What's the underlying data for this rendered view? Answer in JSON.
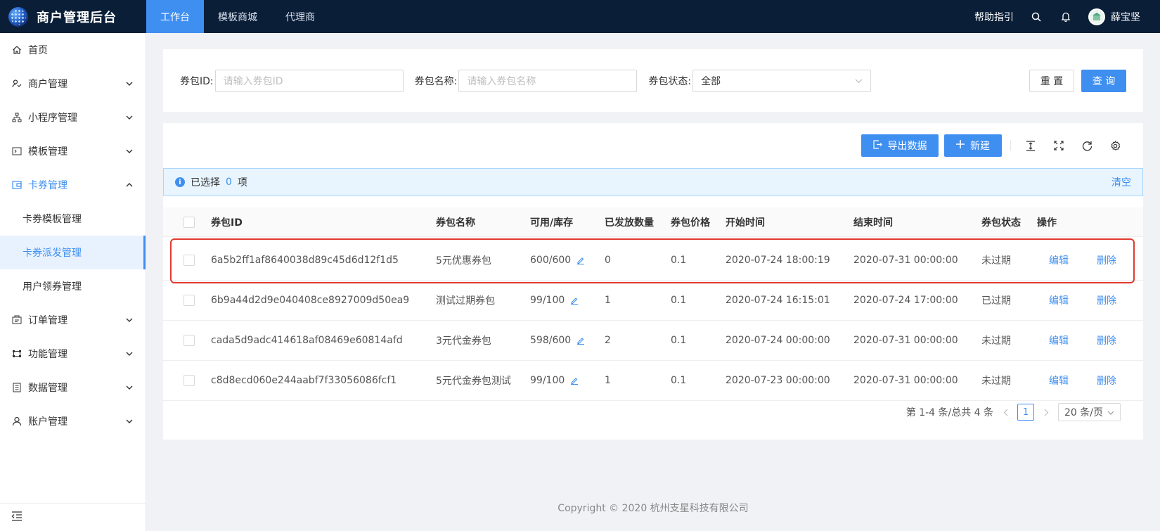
{
  "header": {
    "brand": "商户管理后台",
    "nav": [
      {
        "label": "工作台",
        "active": true
      },
      {
        "label": "模板商城",
        "active": false
      },
      {
        "label": "代理商",
        "active": false
      }
    ],
    "help": "帮助指引",
    "user_name": "薛宝坚"
  },
  "sidebar": {
    "items": [
      {
        "label": "首页",
        "icon": "home-icon"
      },
      {
        "label": "商户管理",
        "icon": "merchant-icon"
      },
      {
        "label": "小程序管理",
        "icon": "sitemap-icon"
      },
      {
        "label": "模板管理",
        "icon": "template-icon"
      },
      {
        "label": "卡券管理",
        "icon": "wallet-icon"
      },
      {
        "label": "订单管理",
        "icon": "order-icon"
      },
      {
        "label": "功能管理",
        "icon": "function-icon"
      },
      {
        "label": "数据管理",
        "icon": "data-icon"
      },
      {
        "label": "账户管理",
        "icon": "user-icon"
      }
    ],
    "sub_items": [
      "卡券模板管理",
      "卡券派发管理",
      "用户领券管理"
    ]
  },
  "filters": {
    "id_label": "券包ID:",
    "id_placeholder": "请输入券包ID",
    "name_label": "券包名称:",
    "name_placeholder": "请输入券包名称",
    "status_label": "券包状态:",
    "status_value": "全部",
    "reset": "重 置",
    "query": "查 询"
  },
  "toolbar": {
    "export": "导出数据",
    "create": "新建"
  },
  "alert": {
    "prefix": "已选择",
    "count": "0",
    "suffix": "项",
    "clear": "清空"
  },
  "table": {
    "columns": [
      "券包ID",
      "券包名称",
      "可用/库存",
      "已发放数量",
      "券包价格",
      "开始时间",
      "结束时间",
      "券包状态",
      "操作"
    ],
    "rows": [
      {
        "id": "6a5b2ff1af8640038d89c45d6d12f1d5",
        "name": "5元优惠券包",
        "stock": "600/600",
        "issued": "0",
        "price": "0.1",
        "start": "2020-07-24 18:00:19",
        "end": "2020-07-31 00:00:00",
        "status": "未过期",
        "edit": "编辑",
        "delete": "删除"
      },
      {
        "id": "6b9a44d2d9e040408ce8927009d50ea9",
        "name": "测试过期券包",
        "stock": "99/100",
        "issued": "1",
        "price": "0.1",
        "start": "2020-07-24 16:15:01",
        "end": "2020-07-24 17:00:00",
        "status": "已过期",
        "edit": "编辑",
        "delete": "删除"
      },
      {
        "id": "cada5d9adc414618af08469e60814afd",
        "name": "3元代金券包",
        "stock": "598/600",
        "issued": "2",
        "price": "0.1",
        "start": "2020-07-24 00:00:00",
        "end": "2020-07-31 00:00:00",
        "status": "未过期",
        "edit": "编辑",
        "delete": "删除"
      },
      {
        "id": "c8d8ecd060e244aabf7f33056086fcf1",
        "name": "5元代金券包测试",
        "stock": "99/100",
        "issued": "1",
        "price": "0.1",
        "start": "2020-07-23 00:00:00",
        "end": "2020-07-31 00:00:00",
        "status": "未过期",
        "edit": "编辑",
        "delete": "删除"
      }
    ]
  },
  "pagination": {
    "summary": "第 1-4 条/总共 4 条",
    "current": "1",
    "page_size": "20 条/页"
  },
  "footer": "Copyright © 2020 杭州支星科技有限公司",
  "colors": {
    "primary": "#3f8ff0",
    "header_bg": "#0a1e38",
    "highlight": "#e03a2f"
  }
}
